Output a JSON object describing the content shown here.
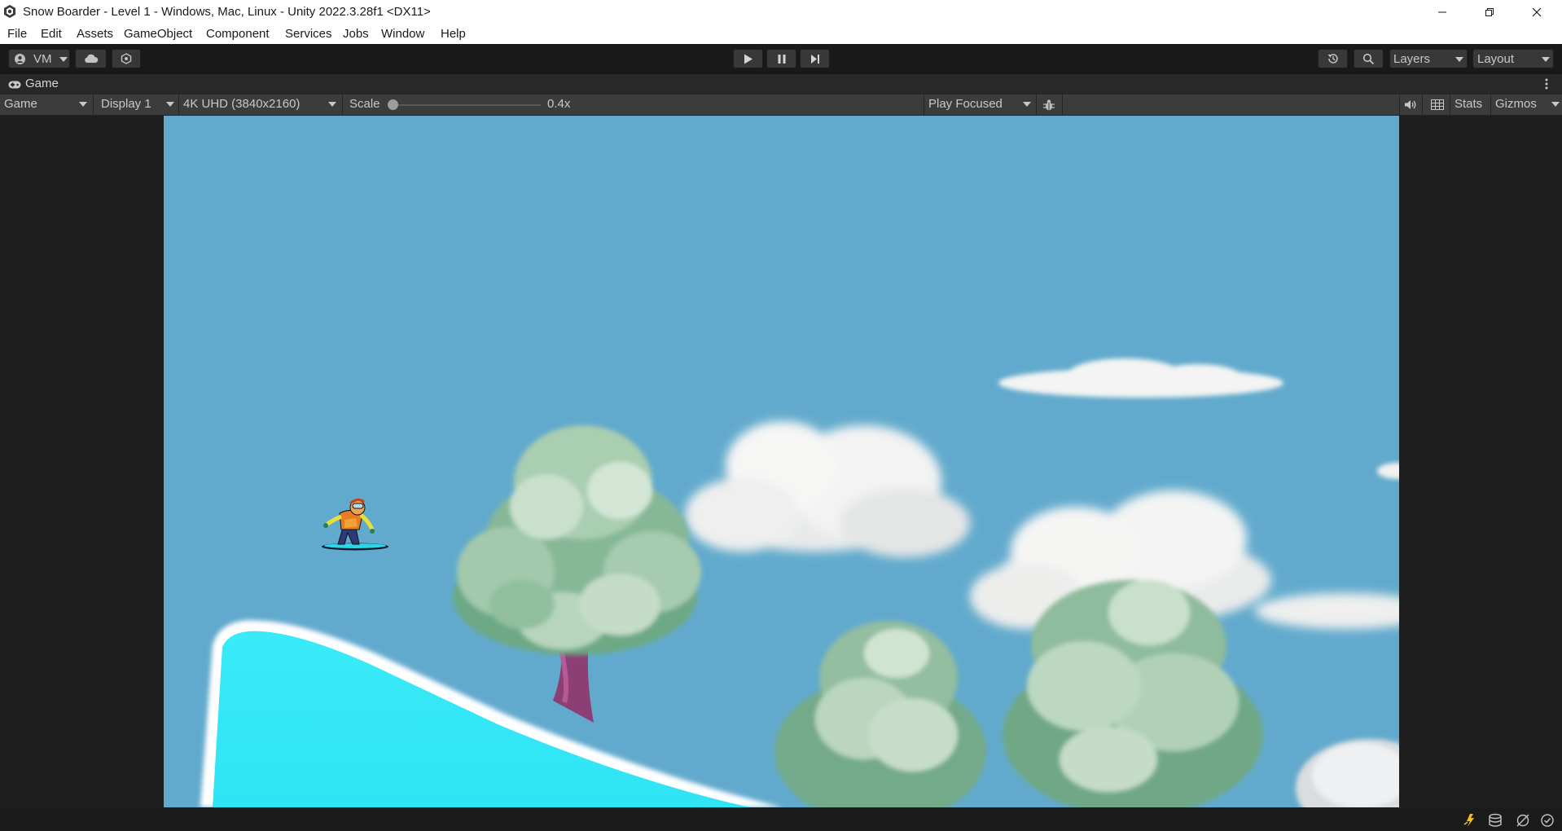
{
  "window": {
    "title": "Snow Boarder - Level 1 - Windows, Mac, Linux - Unity 2022.3.28f1 <DX11>",
    "controls": [
      "minimize-icon",
      "restore-icon",
      "close-icon"
    ]
  },
  "menu": {
    "items": [
      "File",
      "Edit",
      "Assets",
      "GameObject",
      "Component",
      "Services",
      "Jobs",
      "Window",
      "Help"
    ]
  },
  "toolbar": {
    "account_label": "VM",
    "layers_label": "Layers",
    "layout_label": "Layout",
    "icons": [
      "account-icon",
      "cloud-icon",
      "collab-icon",
      "play-icon",
      "pause-icon",
      "step-icon",
      "history-icon",
      "search-icon"
    ]
  },
  "game_tab": {
    "label": "Game"
  },
  "game_controls": {
    "view_mode": "Game",
    "display": "Display 1",
    "resolution": "4K UHD (3840x2160)",
    "scale_label": "Scale",
    "scale_value": "0.4x",
    "scale_level": 0.0,
    "play_mode": "Play Focused",
    "stats_label": "Stats",
    "gizmos_label": "Gizmos"
  },
  "scene": {
    "sky_color": "#62aacd",
    "snow_color": "#33e6f6",
    "elements": [
      "snowboarder",
      "tree",
      "cloud",
      "snow-slope"
    ]
  },
  "colors": {
    "editor_bg": "#191919",
    "toolbar_button": "#383838",
    "panel_bar": "#3c3c3c"
  }
}
